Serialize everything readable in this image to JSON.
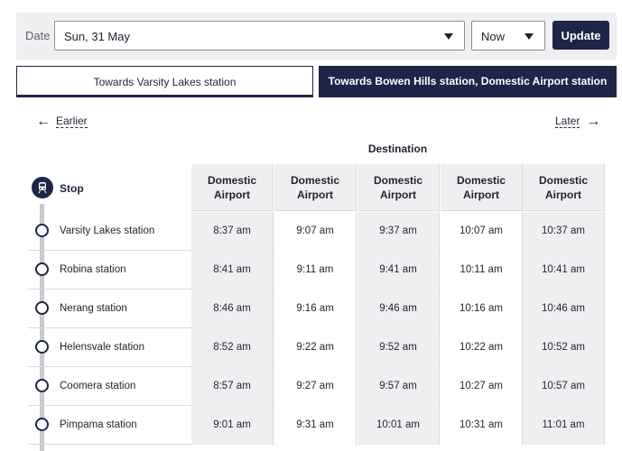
{
  "filter": {
    "date_label": "Date",
    "date_value": "Sun, 31 May",
    "time_value": "Now",
    "update_label": "Update"
  },
  "tabs": [
    {
      "label": "Towards Varsity Lakes station",
      "active": false
    },
    {
      "label": "Towards Bowen Hills station, Domestic Airport station",
      "active": true
    }
  ],
  "nav": {
    "earlier_label": "Earlier",
    "later_label": "Later"
  },
  "table": {
    "destination_heading": "Destination",
    "stop_heading": "Stop",
    "destinations": [
      "Domestic Airport",
      "Domestic Airport",
      "Domestic Airport",
      "Domestic Airport",
      "Domestic Airport"
    ],
    "rows": [
      {
        "stop": "Varsity Lakes station",
        "times": [
          "8:37 am",
          "9:07 am",
          "9:37 am",
          "10:07 am",
          "10:37 am"
        ]
      },
      {
        "stop": "Robina station",
        "times": [
          "8:41 am",
          "9:11 am",
          "9:41 am",
          "10:11 am",
          "10:41 am"
        ]
      },
      {
        "stop": "Nerang station",
        "times": [
          "8:46 am",
          "9:16 am",
          "9:46 am",
          "10:16 am",
          "10:46 am"
        ]
      },
      {
        "stop": "Helensvale station",
        "times": [
          "8:52 am",
          "9:22 am",
          "9:52 am",
          "10:22 am",
          "10:52 am"
        ]
      },
      {
        "stop": "Coomera station",
        "times": [
          "8:57 am",
          "9:27 am",
          "9:57 am",
          "10:27 am",
          "10:57 am"
        ]
      },
      {
        "stop": "Pimpama station",
        "times": [
          "9:01 am",
          "9:31 am",
          "10:01 am",
          "10:31 am",
          "11:01 am"
        ]
      }
    ]
  },
  "colors": {
    "accent": "#1e2546",
    "shade": "#efeff2"
  },
  "icons": {
    "stop_header": "train-icon",
    "earlier": "arrow-left-icon",
    "later": "arrow-right-icon"
  }
}
